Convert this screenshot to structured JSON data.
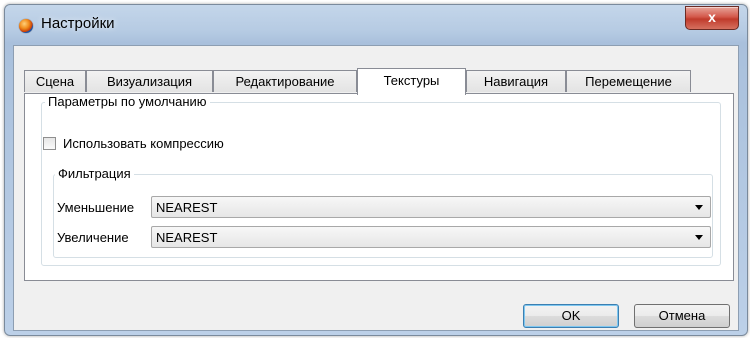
{
  "window": {
    "title": "Настройки",
    "close_label": "x"
  },
  "tabs": [
    {
      "label": "Сцена",
      "active": false
    },
    {
      "label": "Визуализация",
      "active": false
    },
    {
      "label": "Редактирование",
      "active": false
    },
    {
      "label": "Текстуры",
      "active": true
    },
    {
      "label": "Навигация",
      "active": false
    },
    {
      "label": "Перемещение",
      "active": false
    }
  ],
  "defaults_group": {
    "legend": "Параметры по  умолчанию",
    "compression_checkbox": {
      "label": "Использовать компрессию",
      "checked": false
    }
  },
  "filter_group": {
    "legend": "Фильтрация",
    "minification": {
      "label": "Уменьшение",
      "value": "NEAREST"
    },
    "magnification": {
      "label": "Увеличение",
      "value": "NEAREST"
    }
  },
  "buttons": {
    "ok": "OK",
    "cancel": "Отмена"
  }
}
